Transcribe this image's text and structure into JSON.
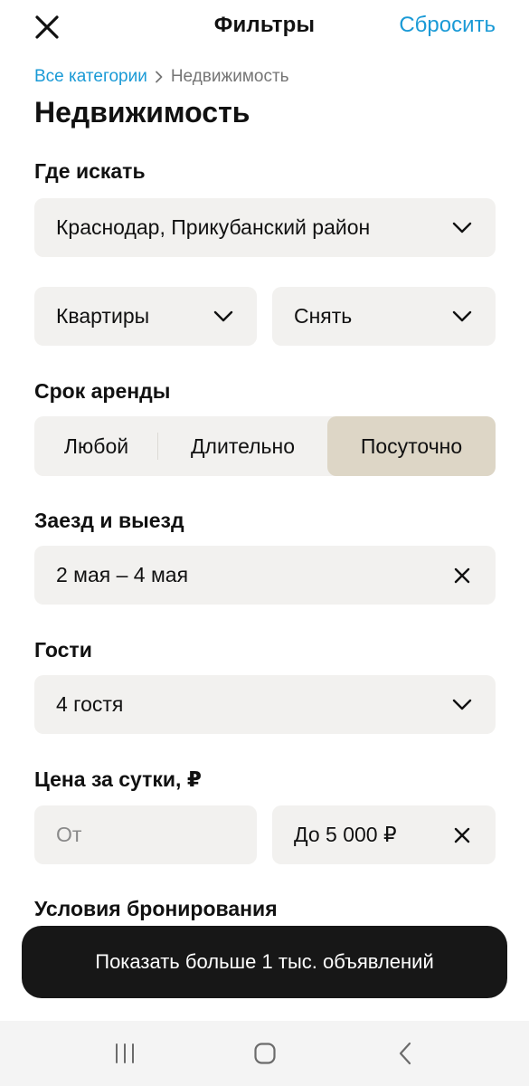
{
  "header": {
    "title": "Фильтры",
    "reset_label": "Сбросить",
    "close_icon": "close-icon"
  },
  "breadcrumb": {
    "parent": "Все категории",
    "current": "Недвижимость"
  },
  "page_title": "Недвижимость",
  "location": {
    "label": "Где искать",
    "value": "Краснодар, Прикубанский район"
  },
  "property_type": {
    "value": "Квартиры"
  },
  "deal_type": {
    "value": "Снять"
  },
  "rental_term": {
    "label": "Срок аренды",
    "options": [
      "Любой",
      "Длительно",
      "Посуточно"
    ],
    "selected": "Посуточно"
  },
  "dates": {
    "label": "Заезд и выезд",
    "value": "2 мая – 4 мая"
  },
  "guests": {
    "label": "Гости",
    "value": "4 гостя"
  },
  "price": {
    "label": "Цена за сутки, ₽",
    "from_placeholder": "От",
    "to_value": "До 5 000 ₽"
  },
  "booking_conditions": {
    "label": "Условия бронирования"
  },
  "cta": {
    "label": "Показать больше 1 тыс. объявлений"
  },
  "colors": {
    "accent": "#1a9ad6",
    "field_bg": "#f2f1ef",
    "segment_selected": "#ddd6c6",
    "cta_bg": "#171717"
  }
}
